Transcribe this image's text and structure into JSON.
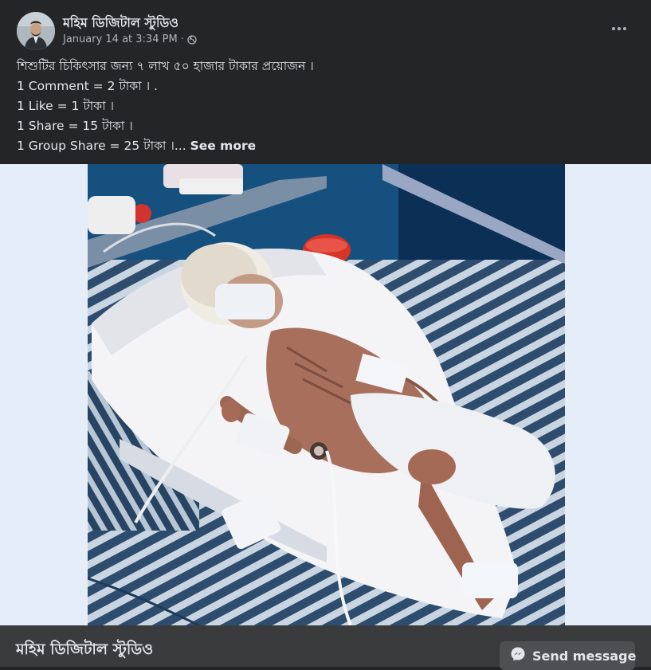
{
  "post": {
    "author": "মহিম ডিজিটাল স্টুডিও",
    "timestamp": "January 14 at 3:34 PM",
    "separator": "·",
    "privacy_icon": "globe-icon",
    "menu_icon": "more-options-icon",
    "text_lines": [
      "শিশুটির চিকিৎসার জন্য ৭ লাখ ৫০ হাজার টাকার প্রয়োজন ।",
      "1 Comment = 2 টাকা । .",
      "1 Like = 1 টাকা ।",
      "1 Share = 15 টাকা ।",
      "1 Group Share = 25 টাকা ।..."
    ],
    "see_more": "See more"
  },
  "footer": {
    "page_name": "মহিম ডিজিটাল স্টুডিও",
    "send_message": "Send message",
    "send_icon": "messenger-icon"
  },
  "colors": {
    "background": "#242526",
    "text_primary": "#e4e6eb",
    "text_secondary": "#b0b3b8",
    "footer_bg": "#3a3b3c",
    "button_bg": "#4e4f50"
  }
}
